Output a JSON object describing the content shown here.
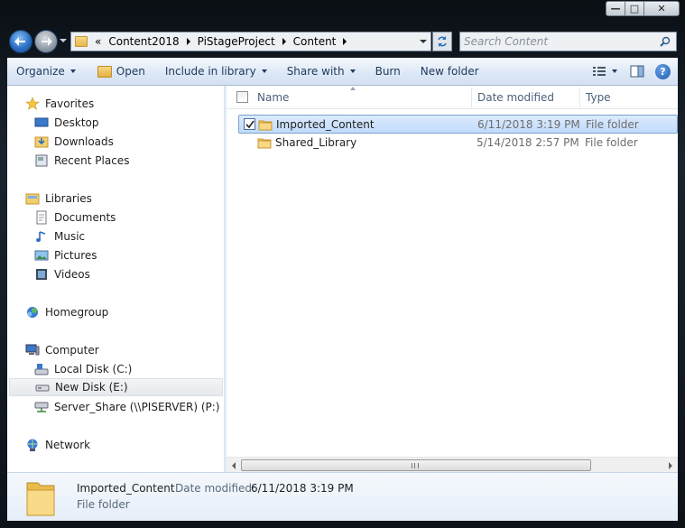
{
  "window": {
    "minimize_glyph": "—",
    "maximize_glyph": "□",
    "close_glyph": "✕"
  },
  "address": {
    "overflow": "«",
    "crumbs": [
      "Content2018",
      "PiStageProject",
      "Content"
    ]
  },
  "search": {
    "placeholder": "Search Content"
  },
  "toolbar": {
    "organize": "Organize",
    "open": "Open",
    "include_in_library": "Include in library",
    "share_with": "Share with",
    "burn": "Burn",
    "new_folder": "New folder",
    "help": "?"
  },
  "nav": {
    "favorites": {
      "label": "Favorites",
      "items": [
        "Desktop",
        "Downloads",
        "Recent Places"
      ]
    },
    "libraries": {
      "label": "Libraries",
      "items": [
        "Documents",
        "Music",
        "Pictures",
        "Videos"
      ]
    },
    "homegroup": {
      "label": "Homegroup"
    },
    "computer": {
      "label": "Computer",
      "items": [
        "Local Disk (C:)",
        "New Disk (E:)",
        "Server_Share (\\\\PISERVER) (P:)"
      ]
    },
    "network": {
      "label": "Network"
    },
    "selected": "New Disk (E:)"
  },
  "columns": {
    "name": "Name",
    "date_modified": "Date modified",
    "type": "Type"
  },
  "files": [
    {
      "name": "Imported_Content",
      "date": "6/11/2018 3:19 PM",
      "type": "File folder",
      "selected": true,
      "checked": true
    },
    {
      "name": "Shared_Library",
      "date": "5/14/2018 2:57 PM",
      "type": "File folder",
      "selected": false,
      "checked": false
    }
  ],
  "details": {
    "name": "Imported_Content",
    "date_label": "Date modified:",
    "date": "6/11/2018 3:19 PM",
    "type": "File folder"
  },
  "colors": {
    "selection_bg": "#c1dbfc",
    "selection_border": "#7da2ce",
    "folder": "#e8b84a",
    "toolbar_text": "#1e395b"
  },
  "icons": {
    "back": "back-arrow-icon",
    "forward": "forward-arrow-icon",
    "refresh": "refresh-icon",
    "search": "search-icon",
    "folder": "folder-icon"
  }
}
